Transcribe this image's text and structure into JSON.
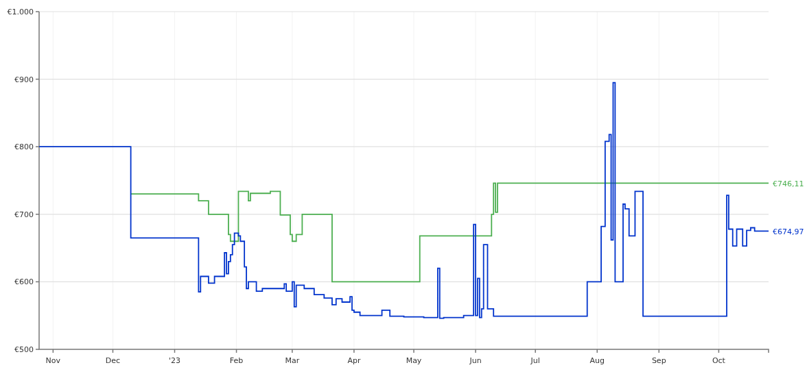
{
  "chart_data": {
    "type": "line",
    "grid": true,
    "xlim": [
      "2022-10-25",
      "2023-10-26"
    ],
    "ylim": [
      500,
      1000
    ],
    "xticks": [
      {
        "value": "2022-11-01",
        "label": "Nov"
      },
      {
        "value": "2022-12-01",
        "label": "Dec"
      },
      {
        "value": "2023-01-01",
        "label": "'23"
      },
      {
        "value": "2023-02-01",
        "label": "Feb"
      },
      {
        "value": "2023-03-01",
        "label": "Mar"
      },
      {
        "value": "2023-04-01",
        "label": "Apr"
      },
      {
        "value": "2023-05-01",
        "label": "May"
      },
      {
        "value": "2023-06-01",
        "label": "Jun"
      },
      {
        "value": "2023-07-01",
        "label": "Jul"
      },
      {
        "value": "2023-08-01",
        "label": "Aug"
      },
      {
        "value": "2023-09-01",
        "label": "Sep"
      },
      {
        "value": "2023-10-01",
        "label": "Oct"
      }
    ],
    "yticks": [
      {
        "value": 500,
        "label": "€500"
      },
      {
        "value": 600,
        "label": "€600"
      },
      {
        "value": 700,
        "label": "€700"
      },
      {
        "value": 800,
        "label": "€800"
      },
      {
        "value": 900,
        "label": "€900"
      },
      {
        "value": 1000,
        "label": "€1.000"
      }
    ],
    "series": [
      {
        "color": "#4caf50",
        "x": [
          "2022-12-10",
          "2023-01-13",
          "2023-01-13",
          "2023-01-18",
          "2023-01-18",
          "2023-01-28",
          "2023-01-28",
          "2023-01-29",
          "2023-01-29",
          "2023-02-02",
          "2023-02-02",
          "2023-02-07",
          "2023-02-07",
          "2023-02-08",
          "2023-02-08",
          "2023-02-18",
          "2023-02-18",
          "2023-02-23",
          "2023-02-23",
          "2023-02-28",
          "2023-02-28",
          "2023-03-01",
          "2023-03-01",
          "2023-03-03",
          "2023-03-03",
          "2023-03-06",
          "2023-03-06",
          "2023-03-07",
          "2023-03-21",
          "2023-03-21",
          "2023-04-12",
          "2023-05-04",
          "2023-05-04",
          "2023-05-17",
          "2023-06-09",
          "2023-06-09",
          "2023-06-10",
          "2023-06-10",
          "2023-06-11",
          "2023-06-11",
          "2023-06-12",
          "2023-06-12",
          "2023-06-20",
          "2023-10-26"
        ],
        "values": [
          730,
          730,
          720,
          720,
          700,
          700,
          670,
          670,
          660,
          660,
          734,
          734,
          720,
          720,
          731,
          731,
          734,
          734,
          699,
          699,
          670,
          670,
          660,
          660,
          670,
          670,
          700,
          700,
          700,
          600,
          600,
          600,
          668,
          668,
          668,
          700,
          700,
          746,
          746,
          703,
          703,
          746,
          746,
          746
        ]
      },
      {
        "color": "#0033cc",
        "x": [
          "2022-10-25",
          "2022-12-10",
          "2022-12-10",
          "2023-01-13",
          "2023-01-13",
          "2023-01-14",
          "2023-01-14",
          "2023-01-18",
          "2023-01-18",
          "2023-01-21",
          "2023-01-21",
          "2023-01-26",
          "2023-01-26",
          "2023-01-27",
          "2023-01-27",
          "2023-01-28",
          "2023-01-28",
          "2023-01-29",
          "2023-01-29",
          "2023-01-30",
          "2023-01-30",
          "2023-01-31",
          "2023-01-31",
          "2023-02-02",
          "2023-02-02",
          "2023-02-03",
          "2023-02-03",
          "2023-02-05",
          "2023-02-05",
          "2023-02-06",
          "2023-02-06",
          "2023-02-07",
          "2023-02-07",
          "2023-02-11",
          "2023-02-11",
          "2023-02-14",
          "2023-02-14",
          "2023-02-25",
          "2023-02-25",
          "2023-02-26",
          "2023-02-26",
          "2023-03-01",
          "2023-03-01",
          "2023-03-02",
          "2023-03-02",
          "2023-03-03",
          "2023-03-03",
          "2023-03-07",
          "2023-03-07",
          "2023-03-12",
          "2023-03-12",
          "2023-03-17",
          "2023-03-17",
          "2023-03-21",
          "2023-03-21",
          "2023-03-23",
          "2023-03-23",
          "2023-03-26",
          "2023-03-26",
          "2023-03-30",
          "2023-03-30",
          "2023-03-31",
          "2023-03-31",
          "2023-04-01",
          "2023-04-01",
          "2023-04-04",
          "2023-04-04",
          "2023-04-15",
          "2023-04-15",
          "2023-04-19",
          "2023-04-19",
          "2023-04-26",
          "2023-04-26",
          "2023-05-06",
          "2023-05-06",
          "2023-05-13",
          "2023-05-13",
          "2023-05-14",
          "2023-05-14",
          "2023-05-16",
          "2023-05-16",
          "2023-05-26",
          "2023-05-26",
          "2023-05-31",
          "2023-05-31",
          "2023-06-01",
          "2023-06-01",
          "2023-06-02",
          "2023-06-02",
          "2023-06-03",
          "2023-06-03",
          "2023-06-04",
          "2023-06-04",
          "2023-06-05",
          "2023-06-05",
          "2023-06-07",
          "2023-06-07",
          "2023-06-10",
          "2023-06-10",
          "2023-06-26",
          "2023-07-27",
          "2023-07-27",
          "2023-07-29",
          "2023-08-03",
          "2023-08-03",
          "2023-08-05",
          "2023-08-05",
          "2023-08-07",
          "2023-08-07",
          "2023-08-08",
          "2023-08-08",
          "2023-08-09",
          "2023-08-09",
          "2023-08-10",
          "2023-08-10",
          "2023-08-14",
          "2023-08-14",
          "2023-08-15",
          "2023-08-15",
          "2023-08-17",
          "2023-08-17",
          "2023-08-20",
          "2023-08-20",
          "2023-08-24",
          "2023-08-24",
          "2023-08-31",
          "2023-10-05",
          "2023-10-05",
          "2023-10-06",
          "2023-10-06",
          "2023-10-08",
          "2023-10-08",
          "2023-10-10",
          "2023-10-10",
          "2023-10-13",
          "2023-10-13",
          "2023-10-15",
          "2023-10-15",
          "2023-10-17",
          "2023-10-17",
          "2023-10-19",
          "2023-10-19",
          "2023-10-26"
        ],
        "values": [
          800,
          800,
          665,
          665,
          585,
          585,
          608,
          608,
          598,
          598,
          608,
          608,
          643,
          643,
          612,
          612,
          630,
          630,
          640,
          640,
          655,
          655,
          672,
          672,
          668,
          668,
          660,
          660,
          622,
          622,
          590,
          590,
          600,
          600,
          586,
          586,
          590,
          590,
          597,
          597,
          586,
          586,
          600,
          600,
          563,
          563,
          595,
          595,
          590,
          590,
          581,
          581,
          576,
          576,
          566,
          566,
          575,
          575,
          570,
          570,
          578,
          578,
          558,
          558,
          555,
          555,
          550,
          550,
          558,
          558,
          549,
          549,
          548,
          548,
          547,
          547,
          620,
          620,
          546,
          546,
          547,
          547,
          550,
          550,
          685,
          685,
          550,
          550,
          605,
          605,
          547,
          547,
          560,
          560,
          655,
          655,
          560,
          560,
          549,
          549,
          549,
          600,
          600,
          600,
          682,
          682,
          808,
          808,
          818,
          818,
          662,
          662,
          895,
          895,
          600,
          600,
          715,
          715,
          708,
          708,
          668,
          668,
          734,
          734,
          549,
          549,
          549,
          728,
          728,
          678,
          678,
          653,
          653,
          678,
          678,
          653,
          653,
          676,
          676,
          680,
          680,
          675,
          675
        ]
      }
    ],
    "annotations": [
      "€746,11",
      "€674,97"
    ]
  }
}
